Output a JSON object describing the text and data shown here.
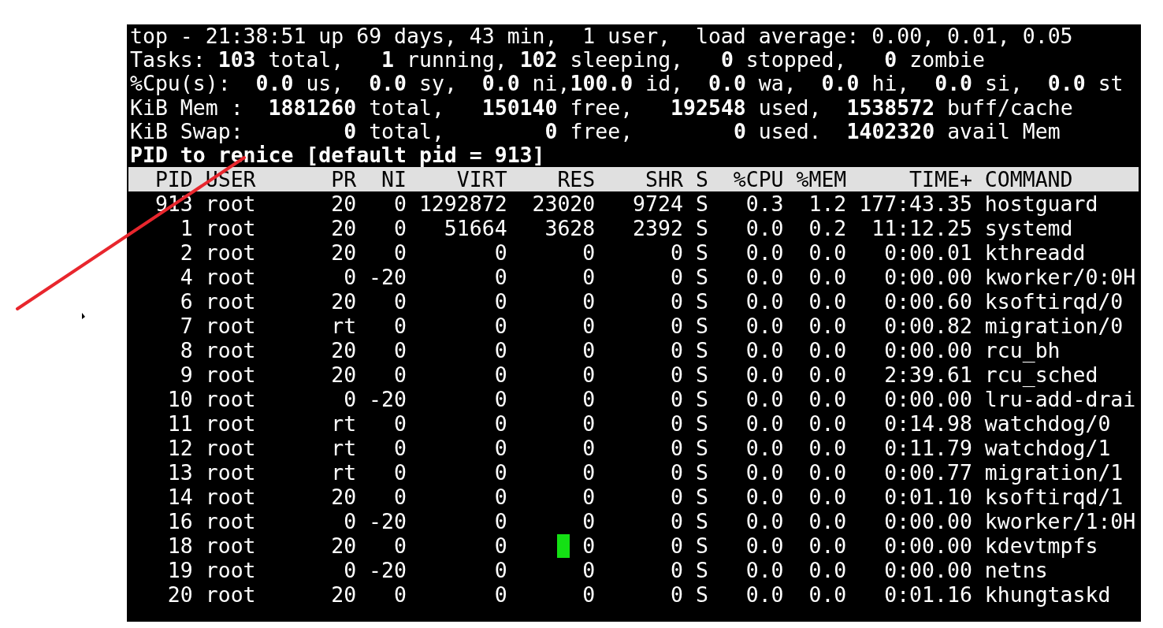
{
  "terminal": {
    "summary_lines": [
      "top - 21:38:51 up 69 days, 43 min,  1 user,  load average: 0.00, 0.01, 0.05",
      "Tasks: **103** total,   **1** running, **102** sleeping,   **0** stopped,   **0** zombie",
      "%Cpu(s):  **0.0** us,  **0.0** sy,  **0.0** ni,**100.0** id,  **0.0** wa,  **0.0** hi,  **0.0** si,  **0.0** st",
      "KiB Mem :  **1881260** total,   **150140** free,   **192548** used,  **1538572** buff/cache",
      "KiB Swap:        **0** total,        **0** free,        **0** used.  **1402320** avail Mem"
    ],
    "prompt": "PID to renice [default pid = 913]"
  },
  "table": {
    "columns": [
      "PID",
      "USER",
      "PR",
      "NI",
      "VIRT",
      "RES",
      "SHR",
      "S",
      "%CPU",
      "%MEM",
      "TIME+",
      "COMMAND"
    ],
    "rows": [
      [
        "913",
        "root",
        "20",
        "0",
        "1292872",
        "23020",
        "9724",
        "S",
        "0.3",
        "1.2",
        "177:43.35",
        "hostguard"
      ],
      [
        "1",
        "root",
        "20",
        "0",
        "51664",
        "3628",
        "2392",
        "S",
        "0.0",
        "0.2",
        "11:12.25",
        "systemd"
      ],
      [
        "2",
        "root",
        "20",
        "0",
        "0",
        "0",
        "0",
        "S",
        "0.0",
        "0.0",
        "0:00.01",
        "kthreadd"
      ],
      [
        "4",
        "root",
        "0",
        "-20",
        "0",
        "0",
        "0",
        "S",
        "0.0",
        "0.0",
        "0:00.00",
        "kworker/0:0H"
      ],
      [
        "6",
        "root",
        "20",
        "0",
        "0",
        "0",
        "0",
        "S",
        "0.0",
        "0.0",
        "0:00.60",
        "ksoftirqd/0"
      ],
      [
        "7",
        "root",
        "rt",
        "0",
        "0",
        "0",
        "0",
        "S",
        "0.0",
        "0.0",
        "0:00.82",
        "migration/0"
      ],
      [
        "8",
        "root",
        "20",
        "0",
        "0",
        "0",
        "0",
        "S",
        "0.0",
        "0.0",
        "0:00.00",
        "rcu_bh"
      ],
      [
        "9",
        "root",
        "20",
        "0",
        "0",
        "0",
        "0",
        "S",
        "0.0",
        "0.0",
        "2:39.61",
        "rcu_sched"
      ],
      [
        "10",
        "root",
        "0",
        "-20",
        "0",
        "0",
        "0",
        "S",
        "0.0",
        "0.0",
        "0:00.00",
        "lru-add-drai"
      ],
      [
        "11",
        "root",
        "rt",
        "0",
        "0",
        "0",
        "0",
        "S",
        "0.0",
        "0.0",
        "0:14.98",
        "watchdog/0"
      ],
      [
        "12",
        "root",
        "rt",
        "0",
        "0",
        "0",
        "0",
        "S",
        "0.0",
        "0.0",
        "0:11.79",
        "watchdog/1"
      ],
      [
        "13",
        "root",
        "rt",
        "0",
        "0",
        "0",
        "0",
        "S",
        "0.0",
        "0.0",
        "0:00.77",
        "migration/1"
      ],
      [
        "14",
        "root",
        "20",
        "0",
        "0",
        "0",
        "0",
        "S",
        "0.0",
        "0.0",
        "0:01.10",
        "ksoftirqd/1"
      ],
      [
        "16",
        "root",
        "0",
        "-20",
        "0",
        "0",
        "0",
        "S",
        "0.0",
        "0.0",
        "0:00.00",
        "kworker/1:0H"
      ],
      [
        "18",
        "root",
        "20",
        "0",
        "0",
        "0",
        "0",
        "S",
        "0.0",
        "0.0",
        "0:00.00",
        "kdevtmpfs"
      ],
      [
        "19",
        "root",
        "0",
        "-20",
        "0",
        "0",
        "0",
        "S",
        "0.0",
        "0.0",
        "0:00.00",
        "netns"
      ],
      [
        "20",
        "root",
        "20",
        "0",
        "0",
        "0",
        "0",
        "S",
        "0.0",
        "0.0",
        "0:01.16",
        "khungtaskd"
      ]
    ]
  }
}
